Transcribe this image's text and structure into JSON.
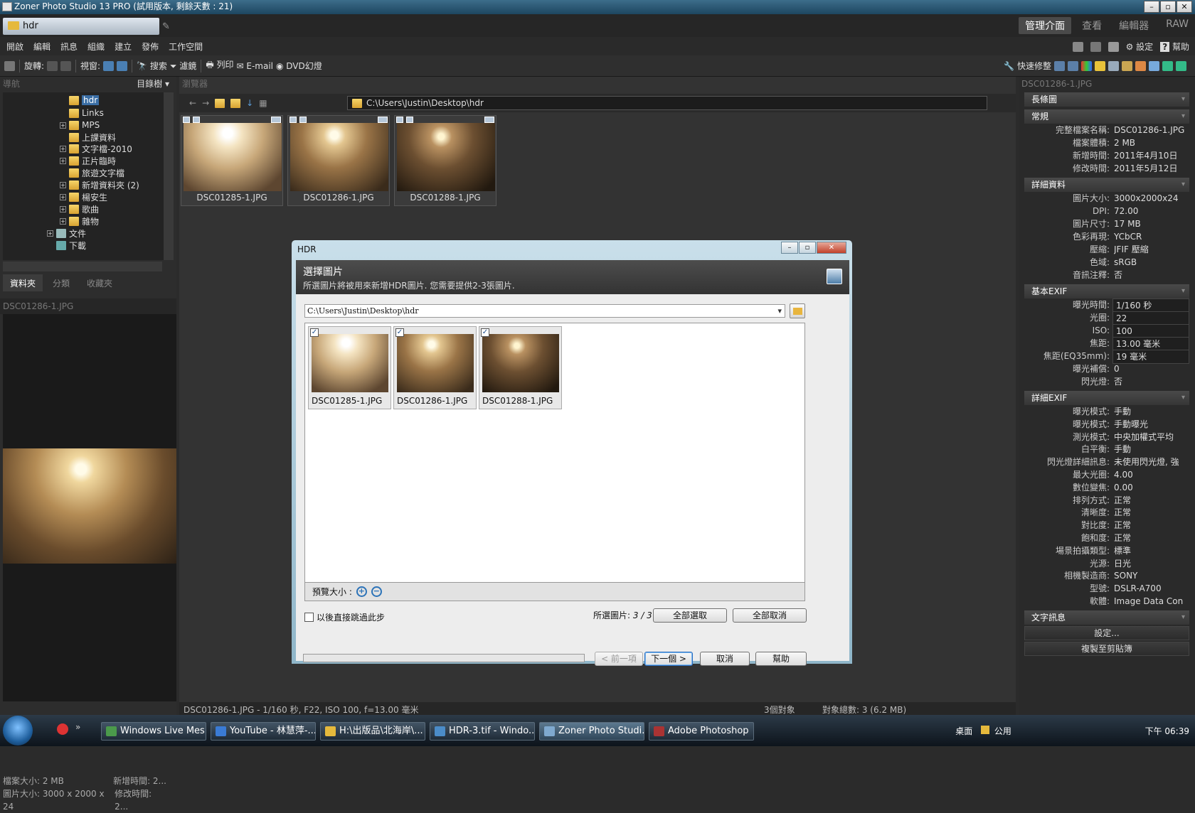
{
  "window": {
    "title": "Zoner Photo Studio 13 PRO (試用版本, 剩餘天數 :  21)"
  },
  "doc_tab": {
    "label": "hdr"
  },
  "modes": [
    "管理介面",
    "查看",
    "編輯器",
    "RAW"
  ],
  "menu": [
    "開啟",
    "編輯",
    "訊息",
    "組織",
    "建立",
    "發佈",
    "工作空間"
  ],
  "menu_right": {
    "settings": "設定",
    "help": "幫助"
  },
  "toolbar": {
    "rotate": "旋轉:",
    "view": "視窗:",
    "search": "搜索",
    "filter": "濾鏡",
    "print": "列印",
    "email": "E-mail",
    "dvd": "DVD幻燈",
    "quickfix": "快速修整"
  },
  "left": {
    "nav_header": "導航",
    "tree_mode": "目錄樹",
    "tree": [
      {
        "label": "hdr",
        "selected": true
      },
      {
        "label": "Links"
      },
      {
        "label": "MPS",
        "expand": true
      },
      {
        "label": "上課資料"
      },
      {
        "label": "文字檔-2010",
        "expand": true
      },
      {
        "label": "正片臨時",
        "expand": true
      },
      {
        "label": "旅遊文字檔"
      },
      {
        "label": "新增資料夾 (2)",
        "expand": true
      },
      {
        "label": "楊安生",
        "expand": true
      },
      {
        "label": "歌曲",
        "expand": true
      },
      {
        "label": "雜物",
        "expand": true
      },
      {
        "label": "文件",
        "expand": true
      },
      {
        "label": "下載"
      }
    ],
    "tabs": [
      "資料夾",
      "分類",
      "收藏夾"
    ],
    "preview_title": "DSC01286-1.JPG",
    "info": {
      "size": "檔案大小: 2 MB",
      "new": "新增時間: 2...",
      "dims": "圖片大小: 3000 x 2000 x 24",
      "mod": "修改時間: 2..."
    }
  },
  "browser": {
    "header": "瀏覽器",
    "path": "C:\\Users\\Justin\\Desktop\\hdr",
    "thumbs": [
      "DSC01285-1.JPG",
      "DSC01286-1.JPG",
      "DSC01288-1.JPG"
    ],
    "status": {
      "info": "DSC01286-1.JPG - 1/160 秒, F22, ISO 100, f=13.00 毫米",
      "count": "3個對象",
      "total": "對象總數: 3 (6.2 MB)"
    }
  },
  "dialog": {
    "title": "HDR",
    "heading": "選擇圖片",
    "subheading": "所選圖片將被用來新增HDR圖片. 您需要提供2-3張圖片.",
    "path": "C:\\Users\\Justin\\Desktop\\hdr",
    "images": [
      "DSC01285-1.JPG",
      "DSC01286-1.JPG",
      "DSC01288-1.JPG"
    ],
    "zoom_label": "預覽大小 :",
    "skip_label": "以後直接跳過此步",
    "selected_label": "所選圖片:",
    "selected_value": "3 / 3",
    "select_all": "全部選取",
    "deselect_all": "全部取消",
    "prev": "< 前一項",
    "next": "下一個 >",
    "cancel": "取消",
    "help": "幫助"
  },
  "right": {
    "header": "DSC01286-1.JPG",
    "sections": {
      "histogram": "長條圖",
      "general": "常規",
      "details": "詳細資料",
      "exif_basic": "基本EXIF",
      "exif_detail": "詳細EXIF",
      "text": "文字訊息"
    },
    "general": [
      [
        "完整檔案名稱:",
        "DSC01286-1.JPG"
      ],
      [
        "檔案體積:",
        "2 MB"
      ],
      [
        "新增時間:",
        "2011年4月10日"
      ],
      [
        "修改時間:",
        "2011年5月12日"
      ]
    ],
    "details": [
      [
        "圖片大小:",
        "3000x2000x24"
      ],
      [
        "DPI:",
        "72.00"
      ],
      [
        "圖片尺寸:",
        "17 MB"
      ],
      [
        "色彩再現:",
        "YCbCR"
      ],
      [
        "壓縮:",
        "JFIF 壓縮"
      ],
      [
        "色域:",
        "sRGB"
      ],
      [
        "音訊注釋:",
        "否"
      ]
    ],
    "exif_basic": [
      [
        "曝光時間:",
        "1/160 秒"
      ],
      [
        "光圈:",
        "22"
      ],
      [
        "ISO:",
        "100"
      ],
      [
        "焦距:",
        "13.00 毫米"
      ],
      [
        "焦距(EQ35mm):",
        "19 毫米"
      ],
      [
        "曝光補償:",
        "0"
      ],
      [
        "閃光燈:",
        "否"
      ]
    ],
    "exif_detail": [
      [
        "曝光模式:",
        "手動"
      ],
      [
        "曝光模式:",
        "手動曝光"
      ],
      [
        "測光模式:",
        "中央加權式平均"
      ],
      [
        "白平衡:",
        "手動"
      ],
      [
        "閃光燈詳細訊息:",
        "未使用閃光燈, 強"
      ],
      [
        "最大光圈:",
        "4.00"
      ],
      [
        "數位變焦:",
        "0.00"
      ],
      [
        "排列方式:",
        "正常"
      ],
      [
        "清晰度:",
        "正常"
      ],
      [
        "對比度:",
        "正常"
      ],
      [
        "飽和度:",
        "正常"
      ],
      [
        "場景拍攝類型:",
        "標準"
      ],
      [
        "光源:",
        "日光"
      ],
      [
        "相機製造商:",
        "SONY"
      ],
      [
        "型號:",
        "DSLR-A700"
      ],
      [
        "軟體:",
        "Image Data Con"
      ]
    ],
    "buttons": {
      "settings": "設定...",
      "copy": "複製至剪貼簿"
    }
  },
  "taskbar": {
    "items": [
      "Windows Live Mes...",
      "YouTube - 林慧萍-...",
      "H:\\出版品\\北海岸\\...",
      "HDR-3.tif - Windo...",
      "Zoner Photo Studi...",
      "Adobe Photoshop"
    ],
    "desktop": "桌面",
    "public": "公用",
    "clock": "下午 06:39"
  }
}
